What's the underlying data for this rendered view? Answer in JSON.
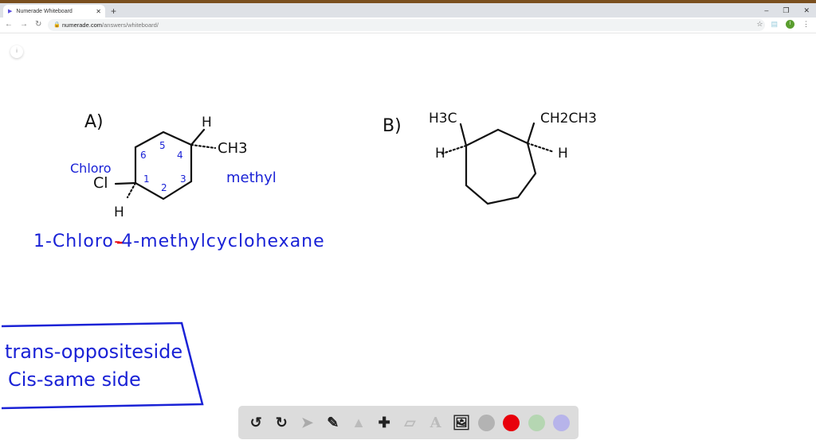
{
  "browser": {
    "tab_title": "Numerade Whiteboard",
    "url_host": "numerade.com",
    "url_path": "/answers/whiteboard/",
    "avatar_letter": "I"
  },
  "board": {
    "a_label": "A)",
    "b_label": "B)",
    "a_h_top": "H",
    "a_ch3": "CH3",
    "a_cl": "Cl",
    "a_h_bottom": "H",
    "a_chloro": "Chloro",
    "a_methyl": "methyl",
    "a_numbers": [
      "6",
      "5",
      "4",
      "1",
      "2",
      "3"
    ],
    "a_name_part1": "1-Chloro",
    "a_name_dash": "-",
    "a_name_part2": "4-methylcyclohexane",
    "b_h3c": "H3C",
    "b_h_left": "H",
    "b_ch2ch3": "CH2CH3",
    "b_h_right": "H",
    "note_trans": "trans-oppositeside",
    "note_cis": "Cis-same side"
  },
  "toolbar": {
    "colors": {
      "gray": "#b3b3b3",
      "red": "#e8000b",
      "green": "#b5d6b2",
      "purple": "#b7b4ea"
    }
  }
}
